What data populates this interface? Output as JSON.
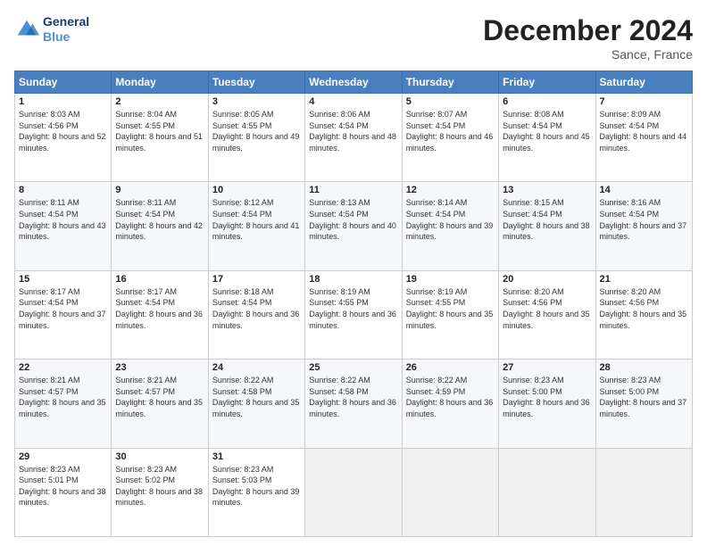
{
  "header": {
    "logo_line1": "General",
    "logo_line2": "Blue",
    "month_year": "December 2024",
    "location": "Sance, France"
  },
  "weekdays": [
    "Sunday",
    "Monday",
    "Tuesday",
    "Wednesday",
    "Thursday",
    "Friday",
    "Saturday"
  ],
  "weeks": [
    [
      {
        "day": "1",
        "rise": "8:03 AM",
        "set": "4:56 PM",
        "daylight": "8 hours and 52 minutes."
      },
      {
        "day": "2",
        "rise": "8:04 AM",
        "set": "4:55 PM",
        "daylight": "8 hours and 51 minutes."
      },
      {
        "day": "3",
        "rise": "8:05 AM",
        "set": "4:55 PM",
        "daylight": "8 hours and 49 minutes."
      },
      {
        "day": "4",
        "rise": "8:06 AM",
        "set": "4:54 PM",
        "daylight": "8 hours and 48 minutes."
      },
      {
        "day": "5",
        "rise": "8:07 AM",
        "set": "4:54 PM",
        "daylight": "8 hours and 46 minutes."
      },
      {
        "day": "6",
        "rise": "8:08 AM",
        "set": "4:54 PM",
        "daylight": "8 hours and 45 minutes."
      },
      {
        "day": "7",
        "rise": "8:09 AM",
        "set": "4:54 PM",
        "daylight": "8 hours and 44 minutes."
      }
    ],
    [
      {
        "day": "8",
        "rise": "8:11 AM",
        "set": "4:54 PM",
        "daylight": "8 hours and 43 minutes."
      },
      {
        "day": "9",
        "rise": "8:11 AM",
        "set": "4:54 PM",
        "daylight": "8 hours and 42 minutes."
      },
      {
        "day": "10",
        "rise": "8:12 AM",
        "set": "4:54 PM",
        "daylight": "8 hours and 41 minutes."
      },
      {
        "day": "11",
        "rise": "8:13 AM",
        "set": "4:54 PM",
        "daylight": "8 hours and 40 minutes."
      },
      {
        "day": "12",
        "rise": "8:14 AM",
        "set": "4:54 PM",
        "daylight": "8 hours and 39 minutes."
      },
      {
        "day": "13",
        "rise": "8:15 AM",
        "set": "4:54 PM",
        "daylight": "8 hours and 38 minutes."
      },
      {
        "day": "14",
        "rise": "8:16 AM",
        "set": "4:54 PM",
        "daylight": "8 hours and 37 minutes."
      }
    ],
    [
      {
        "day": "15",
        "rise": "8:17 AM",
        "set": "4:54 PM",
        "daylight": "8 hours and 37 minutes."
      },
      {
        "day": "16",
        "rise": "8:17 AM",
        "set": "4:54 PM",
        "daylight": "8 hours and 36 minutes."
      },
      {
        "day": "17",
        "rise": "8:18 AM",
        "set": "4:54 PM",
        "daylight": "8 hours and 36 minutes."
      },
      {
        "day": "18",
        "rise": "8:19 AM",
        "set": "4:55 PM",
        "daylight": "8 hours and 36 minutes."
      },
      {
        "day": "19",
        "rise": "8:19 AM",
        "set": "4:55 PM",
        "daylight": "8 hours and 35 minutes."
      },
      {
        "day": "20",
        "rise": "8:20 AM",
        "set": "4:56 PM",
        "daylight": "8 hours and 35 minutes."
      },
      {
        "day": "21",
        "rise": "8:20 AM",
        "set": "4:56 PM",
        "daylight": "8 hours and 35 minutes."
      }
    ],
    [
      {
        "day": "22",
        "rise": "8:21 AM",
        "set": "4:57 PM",
        "daylight": "8 hours and 35 minutes."
      },
      {
        "day": "23",
        "rise": "8:21 AM",
        "set": "4:57 PM",
        "daylight": "8 hours and 35 minutes."
      },
      {
        "day": "24",
        "rise": "8:22 AM",
        "set": "4:58 PM",
        "daylight": "8 hours and 35 minutes."
      },
      {
        "day": "25",
        "rise": "8:22 AM",
        "set": "4:58 PM",
        "daylight": "8 hours and 36 minutes."
      },
      {
        "day": "26",
        "rise": "8:22 AM",
        "set": "4:59 PM",
        "daylight": "8 hours and 36 minutes."
      },
      {
        "day": "27",
        "rise": "8:23 AM",
        "set": "5:00 PM",
        "daylight": "8 hours and 36 minutes."
      },
      {
        "day": "28",
        "rise": "8:23 AM",
        "set": "5:00 PM",
        "daylight": "8 hours and 37 minutes."
      }
    ],
    [
      {
        "day": "29",
        "rise": "8:23 AM",
        "set": "5:01 PM",
        "daylight": "8 hours and 38 minutes."
      },
      {
        "day": "30",
        "rise": "8:23 AM",
        "set": "5:02 PM",
        "daylight": "8 hours and 38 minutes."
      },
      {
        "day": "31",
        "rise": "8:23 AM",
        "set": "5:03 PM",
        "daylight": "8 hours and 39 minutes."
      },
      null,
      null,
      null,
      null
    ]
  ]
}
